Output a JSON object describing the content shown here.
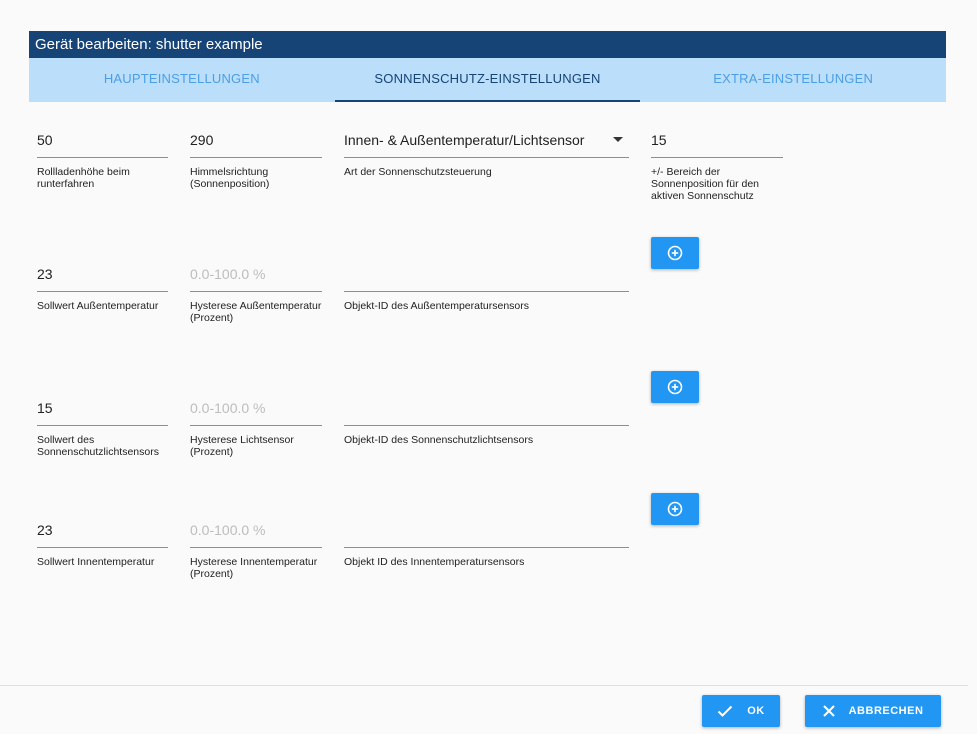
{
  "dialog": {
    "title": "Gerät bearbeiten: shutter example"
  },
  "tabs": [
    {
      "label": "HAUPTEINSTELLUNGEN",
      "active": false
    },
    {
      "label": "SONNENSCHUTZ-EINSTELLUNGEN",
      "active": true
    },
    {
      "label": "EXTRA-EINSTELLUNGEN",
      "active": false
    }
  ],
  "row1": {
    "shutter_height": {
      "value": "50",
      "label": "Rollladenhöhe beim runterfahren"
    },
    "direction": {
      "value": "290",
      "label": "Himmelsrichtung (Sonnenposition)"
    },
    "control_type": {
      "value": "Innen- & Außentemperatur/Lichtsensor",
      "label": "Art der Sonnenschutzsteuerung"
    },
    "sun_range": {
      "value": "15",
      "label": "+/- Bereich der Sonnenposition für den aktiven Sonnenschutz"
    }
  },
  "row2": {
    "setpoint": {
      "value": "23",
      "label": "Sollwert Außentemperatur"
    },
    "hysteresis": {
      "placeholder": "0.0-100.0 %",
      "label": "Hysterese Außentemperatur (Prozent)"
    },
    "object_id": {
      "value": "",
      "label": "Objekt-ID des Außentemperatursensors"
    }
  },
  "row3": {
    "setpoint": {
      "value": "15",
      "label": "Sollwert des Sonnenschutzlichtsensors"
    },
    "hysteresis": {
      "placeholder": "0.0-100.0 %",
      "label": "Hysterese Lichtsensor (Prozent)"
    },
    "object_id": {
      "value": "",
      "label": "Objekt-ID des Sonnenschutzlichtsensors"
    }
  },
  "row4": {
    "setpoint": {
      "value": "23",
      "label": "Sollwert Innentemperatur"
    },
    "hysteresis": {
      "placeholder": "0.0-100.0 %",
      "label": "Hysterese Innentemperatur (Prozent)"
    },
    "object_id": {
      "value": "",
      "label": "Objekt ID des Innentemperatursensors"
    }
  },
  "buttons": {
    "ok": "OK",
    "cancel": "ABBRECHEN"
  },
  "colors": {
    "header": "#164477",
    "tabs_bg": "#bbdefb",
    "accent": "#2196f3"
  },
  "icons": {
    "add": "add-circle-icon",
    "ok": "check-icon",
    "cancel": "close-icon"
  }
}
